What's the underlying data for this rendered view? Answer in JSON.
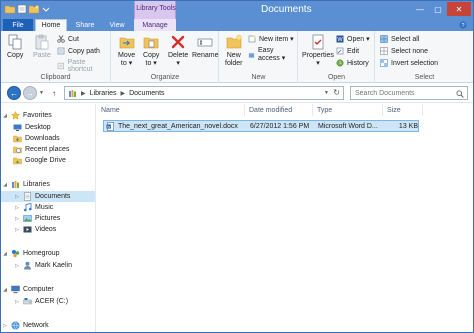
{
  "window": {
    "title": "Documents",
    "context_tab_group": "Library Tools"
  },
  "tabs": [
    {
      "label": "File"
    },
    {
      "label": "Home"
    },
    {
      "label": "Share"
    },
    {
      "label": "View"
    },
    {
      "label": "Manage"
    }
  ],
  "ribbon": {
    "clipboard": {
      "label": "Clipboard",
      "copy": "Copy",
      "paste": "Paste",
      "cut": "Cut",
      "copy_path": "Copy path",
      "paste_shortcut": "Paste shortcut"
    },
    "organize": {
      "label": "Organize",
      "move_to": [
        "Move",
        "to ▾"
      ],
      "copy_to": [
        "Copy",
        "to ▾"
      ],
      "delete": [
        "Delete",
        "▾"
      ],
      "rename": "Rename"
    },
    "new": {
      "label": "New",
      "new_folder": [
        "New",
        "folder"
      ],
      "new_item": "New item ▾",
      "easy_access": "Easy access ▾"
    },
    "open": {
      "label": "Open",
      "properties": [
        "Properties",
        "▾"
      ],
      "open": "Open ▾",
      "edit": "Edit",
      "history": "History"
    },
    "select": {
      "label": "Select",
      "select_all": "Select all",
      "select_none": "Select none",
      "invert_selection": "Invert selection"
    }
  },
  "address": {
    "crumbs": [
      "Libraries",
      "Documents"
    ],
    "search_placeholder": "Search Documents"
  },
  "nav": {
    "favorites": "Favorites",
    "favorites_items": [
      "Desktop",
      "Downloads",
      "Recent places",
      "Google Drive"
    ],
    "libraries": "Libraries",
    "libraries_items": [
      "Documents",
      "Music",
      "Pictures",
      "Videos"
    ],
    "homegroup": "Homegroup",
    "homegroup_items": [
      "Mark Kaelin"
    ],
    "computer": "Computer",
    "computer_items": [
      "ACER (C:)"
    ],
    "network": "Network"
  },
  "columns": [
    "Name",
    "Date modified",
    "Type",
    "Size"
  ],
  "files": [
    {
      "name": "The_next_great_American_novel.docx",
      "date": "6/27/2012 1:56 PM",
      "type": "Microsoft Word D...",
      "size": "13 KB"
    }
  ],
  "colors": {
    "titlebar": "#5a8fd3",
    "file_tab": "#1e5fb8",
    "context": "#d9c7ef",
    "selection": "#cde6f7"
  }
}
